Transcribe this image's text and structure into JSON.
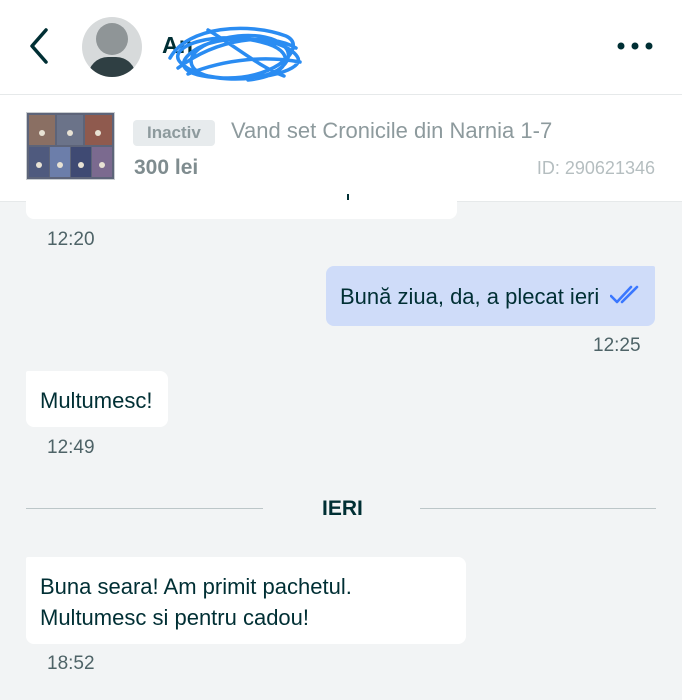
{
  "header": {
    "contact_name": "An",
    "back_icon": "chevron-left-icon",
    "menu_icon": "more-dots-icon"
  },
  "ad": {
    "status": "Inactiv",
    "title": "Vand set Cronicile din Narnia 1-7",
    "price": "300 lei",
    "id": "ID: 290621346"
  },
  "messages": [
    {
      "direction": "in",
      "text": "",
      "time": "12:20"
    },
    {
      "direction": "out",
      "text": "Bună ziua, da, a plecat ieri",
      "time": "12:25",
      "read": true
    },
    {
      "direction": "in",
      "text": "Multumesc!",
      "time": "12:49"
    },
    {
      "direction": "in",
      "text": "Buna seara! Am primit pachetul.\nMultumesc si pentru cadou!",
      "time": "18:52"
    }
  ],
  "separator": {
    "label": "IERI"
  },
  "colors": {
    "accent": "#002f34",
    "outgoing_bubble": "#cfdcf9",
    "read_check": "#3a77ff",
    "scribble": "#2a8cf2"
  }
}
